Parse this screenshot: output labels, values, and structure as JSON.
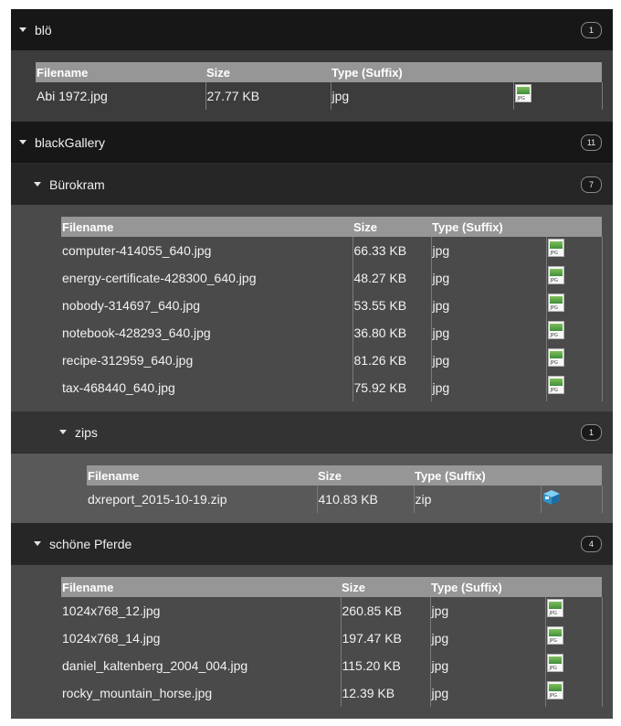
{
  "columns": {
    "filename": "Filename",
    "size": "Size",
    "type": "Type (Suffix)"
  },
  "folders": {
    "blo": {
      "name": "blö",
      "count": "1",
      "files": [
        {
          "name": "Abi 1972.jpg",
          "size": "27.77 KB",
          "type": "jpg",
          "icon": "jpg-file-icon"
        }
      ]
    },
    "blackgallery": {
      "name": "blackGallery",
      "count": "11"
    },
    "burokram": {
      "name": "Bürokram",
      "count": "7",
      "files": [
        {
          "name": "computer-414055_640.jpg",
          "size": "66.33 KB",
          "type": "jpg",
          "icon": "jpg-file-icon"
        },
        {
          "name": "energy-certificate-428300_640.jpg",
          "size": "48.27 KB",
          "type": "jpg",
          "icon": "jpg-file-icon"
        },
        {
          "name": "nobody-314697_640.jpg",
          "size": "53.55 KB",
          "type": "jpg",
          "icon": "jpg-file-icon"
        },
        {
          "name": "notebook-428293_640.jpg",
          "size": "36.80 KB",
          "type": "jpg",
          "icon": "jpg-file-icon"
        },
        {
          "name": "recipe-312959_640.jpg",
          "size": "81.26 KB",
          "type": "jpg",
          "icon": "jpg-file-icon"
        },
        {
          "name": "tax-468440_640.jpg",
          "size": "75.92 KB",
          "type": "jpg",
          "icon": "jpg-file-icon"
        }
      ]
    },
    "zips": {
      "name": "zips",
      "count": "1",
      "files": [
        {
          "name": "dxreport_2015-10-19.zip",
          "size": "410.83 KB",
          "type": "zip",
          "icon": "zip-package-icon"
        }
      ]
    },
    "pferde": {
      "name": "schöne Pferde",
      "count": "4",
      "files": [
        {
          "name": "1024x768_12.jpg",
          "size": "260.85 KB",
          "type": "jpg",
          "icon": "jpg-file-icon"
        },
        {
          "name": "1024x768_14.jpg",
          "size": "197.47 KB",
          "type": "jpg",
          "icon": "jpg-file-icon"
        },
        {
          "name": "daniel_kaltenberg_2004_004.jpg",
          "size": "115.20 KB",
          "type": "jpg",
          "icon": "jpg-file-icon"
        },
        {
          "name": "rocky_mountain_horse.jpg",
          "size": "12.39 KB",
          "type": "jpg",
          "icon": "jpg-file-icon"
        }
      ]
    }
  },
  "colors": {
    "header_dark": "#171717",
    "table_header": "#969696",
    "text": "#f2f2f2"
  }
}
